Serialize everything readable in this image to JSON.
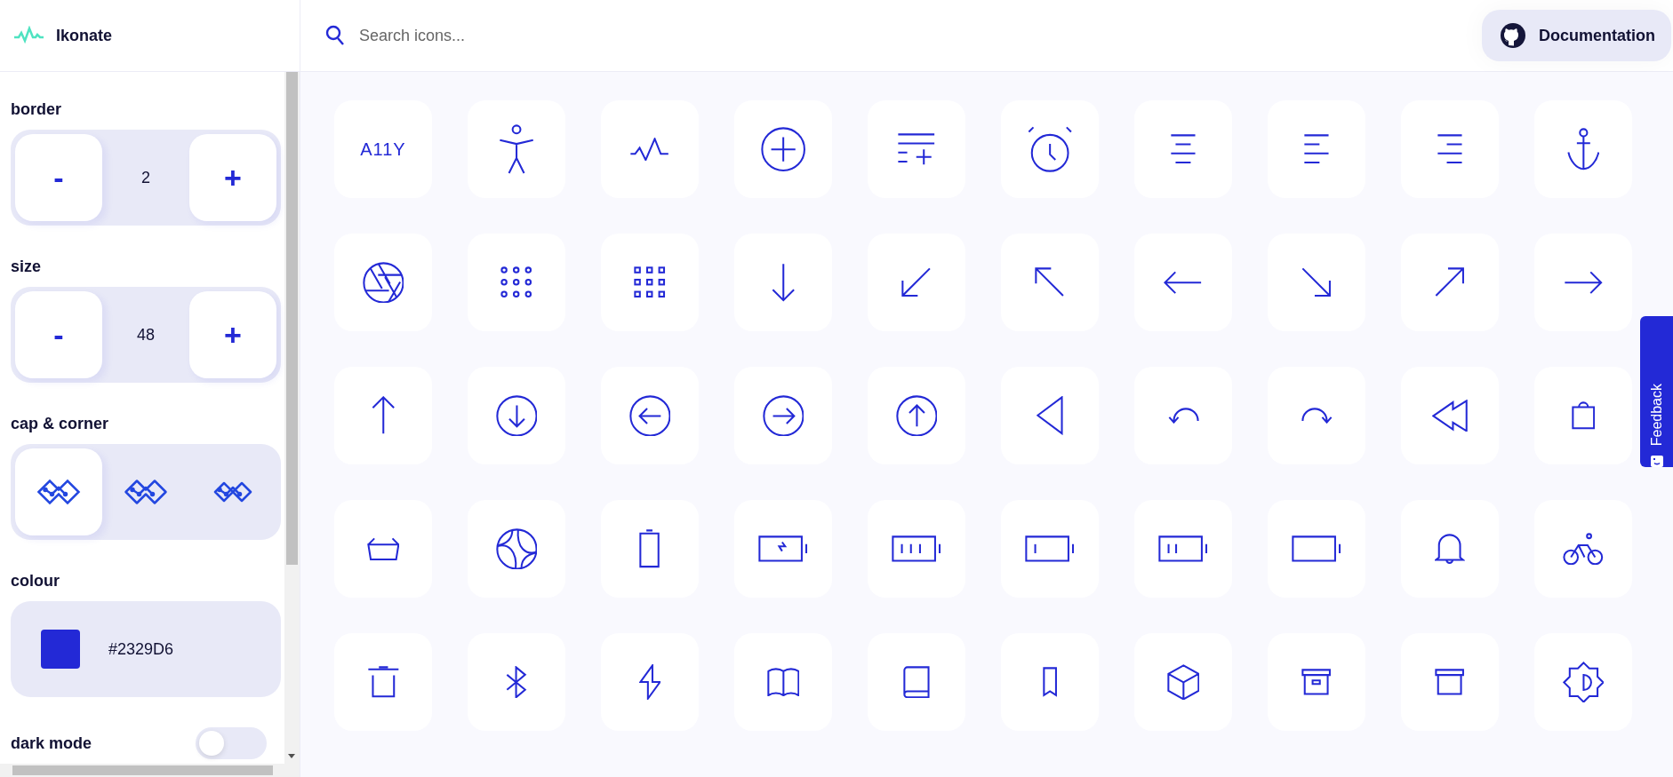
{
  "app": {
    "name": "Ikonate"
  },
  "search": {
    "placeholder": "Search icons..."
  },
  "documentation_button": {
    "label": "Documentation"
  },
  "settings": [
    {
      "kind": "stepper",
      "label": "border",
      "value": "2",
      "decrement": "-",
      "increment": "+"
    },
    {
      "kind": "stepper",
      "label": "size",
      "value": "48",
      "decrement": "-",
      "increment": "+"
    },
    {
      "kind": "options",
      "label": "cap & corner",
      "options": [
        {
          "kind": "square",
          "selected": true
        },
        {
          "kind": "round",
          "selected": false
        },
        {
          "kind": "rounded",
          "selected": false
        }
      ]
    },
    {
      "kind": "colour",
      "label": "colour",
      "value": "#2329D6"
    },
    {
      "kind": "toggle",
      "label": "dark mode",
      "on": false
    }
  ],
  "icons": [
    {
      "kind": "a11y",
      "text": "A11Y"
    },
    {
      "kind": "accessibility"
    },
    {
      "kind": "activity"
    },
    {
      "kind": "add"
    },
    {
      "kind": "addlist"
    },
    {
      "kind": "alarm"
    },
    {
      "kind": "aligncenter"
    },
    {
      "kind": "alignleft"
    },
    {
      "kind": "alignright"
    },
    {
      "kind": "anchor"
    },
    {
      "kind": "aperture"
    },
    {
      "kind": "dots"
    },
    {
      "kind": "squares"
    },
    {
      "kind": "down"
    },
    {
      "kind": "downleft"
    },
    {
      "kind": "upleft"
    },
    {
      "kind": "left"
    },
    {
      "kind": "downright"
    },
    {
      "kind": "upright"
    },
    {
      "kind": "right"
    },
    {
      "kind": "up"
    },
    {
      "kind": "circledown"
    },
    {
      "kind": "circleleft"
    },
    {
      "kind": "circleright"
    },
    {
      "kind": "circleup"
    },
    {
      "kind": "back"
    },
    {
      "kind": "undo"
    },
    {
      "kind": "redo"
    },
    {
      "kind": "rewind"
    },
    {
      "kind": "bag"
    },
    {
      "kind": "basket"
    },
    {
      "kind": "ball"
    },
    {
      "kind": "battery"
    },
    {
      "kind": "charging"
    },
    {
      "kind": "batteryfull"
    },
    {
      "kind": "batterylow"
    },
    {
      "kind": "batterymedium"
    },
    {
      "kind": "batteryempty"
    },
    {
      "kind": "bell"
    },
    {
      "kind": "bicycle"
    },
    {
      "kind": "bin"
    },
    {
      "kind": "bluetooth"
    },
    {
      "kind": "bolt"
    },
    {
      "kind": "bookopen"
    },
    {
      "kind": "book"
    },
    {
      "kind": "bookmark"
    },
    {
      "kind": "cube"
    },
    {
      "kind": "boxlabel"
    },
    {
      "kind": "archive"
    },
    {
      "kind": "brightness"
    }
  ],
  "feedback_tab": {
    "label": "Feedback"
  }
}
